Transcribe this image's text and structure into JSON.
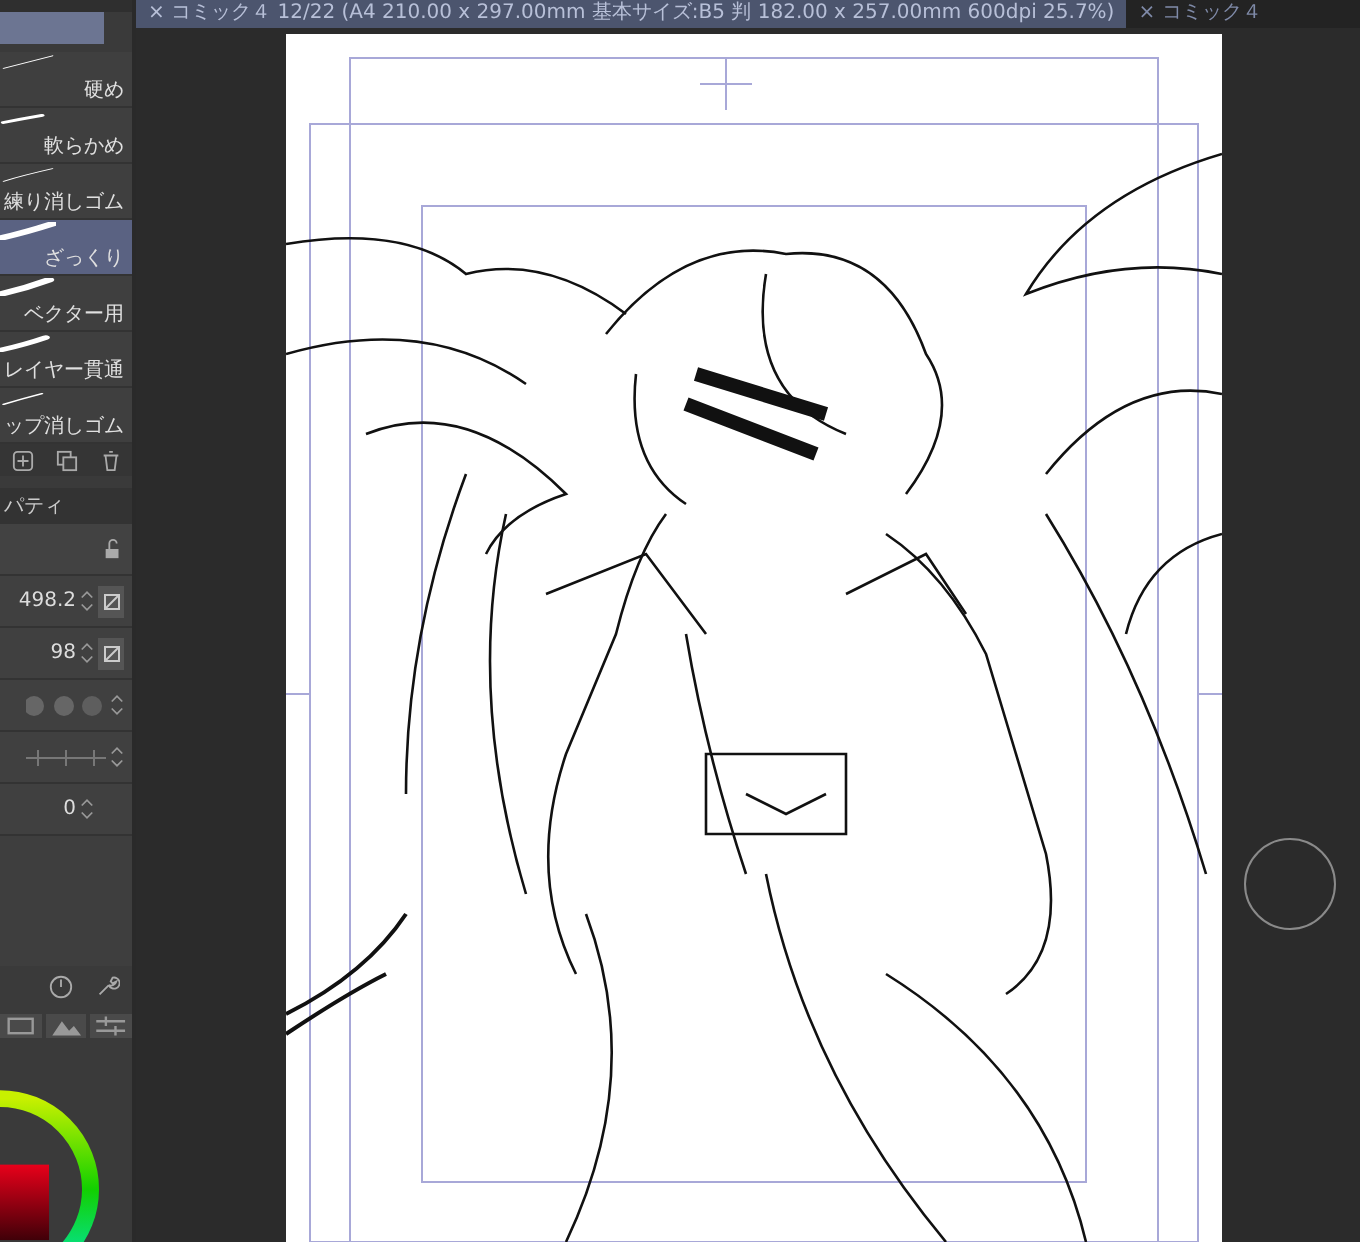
{
  "tabs": [
    {
      "close": "×",
      "label": "コミック４ 12/22 (A4 210.00 x 297.00mm 基本サイズ:B5 判 182.00 x 257.00mm 600dpi 25.7%)",
      "selected": true
    },
    {
      "close": "×",
      "label": "コミック４",
      "selected": false
    }
  ],
  "brushes": [
    {
      "label": "硬め",
      "selected": false
    },
    {
      "label": "軟らかめ",
      "selected": false
    },
    {
      "label": "練り消しゴム",
      "selected": false
    },
    {
      "label": "ざっくり",
      "selected": true
    },
    {
      "label": "ベクター用",
      "selected": false
    },
    {
      "label": "レイヤー貫通",
      "selected": false
    },
    {
      "label": "ップ消しゴム",
      "selected": false
    }
  ],
  "property_panel": {
    "tab": "パティ",
    "fields": [
      {
        "value": "498.2"
      },
      {
        "value": "98"
      }
    ],
    "angle": "0"
  }
}
